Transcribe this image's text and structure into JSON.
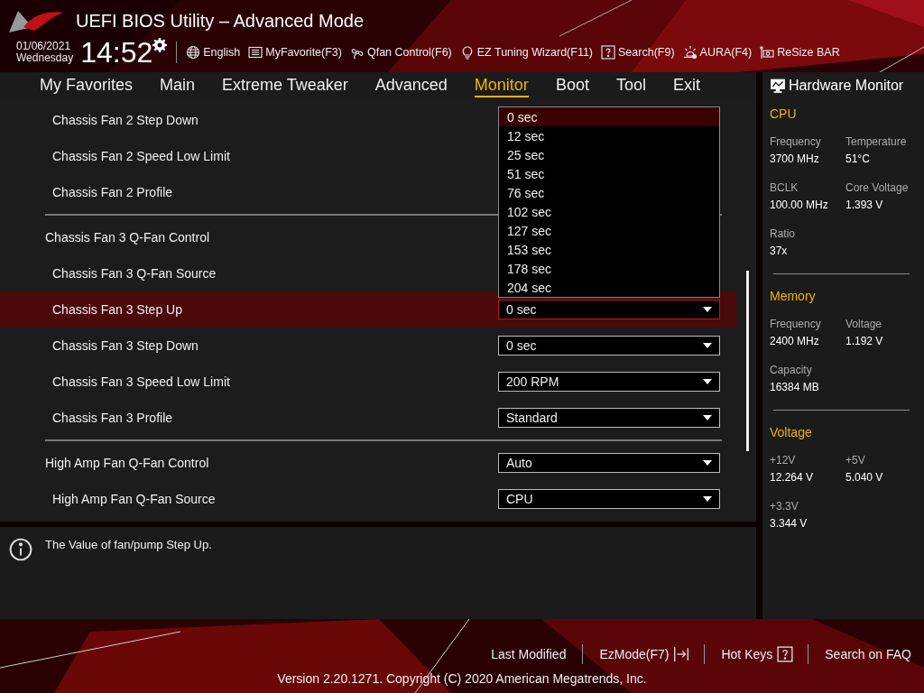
{
  "window": {
    "title": "UEFI BIOS Utility – Advanced Mode"
  },
  "clock": {
    "date": "01/06/2021",
    "day": "Wednesday",
    "time": "14:52"
  },
  "toolbar": [
    {
      "label": "English"
    },
    {
      "label": "MyFavorite(F3)"
    },
    {
      "label": "Qfan Control(F6)"
    },
    {
      "label": "EZ Tuning Wizard(F11)"
    },
    {
      "label": "Search(F9)"
    },
    {
      "label": "AURA(F4)"
    },
    {
      "label": "ReSize BAR"
    }
  ],
  "tabs": [
    {
      "label": "My Favorites",
      "selected": false
    },
    {
      "label": "Main",
      "selected": false
    },
    {
      "label": "Extreme Tweaker",
      "selected": false
    },
    {
      "label": "Advanced",
      "selected": false
    },
    {
      "label": "Monitor",
      "selected": true
    },
    {
      "label": "Boot",
      "selected": false
    },
    {
      "label": "Tool",
      "selected": false
    },
    {
      "label": "Exit",
      "selected": false
    }
  ],
  "settings": [
    {
      "kind": "setting",
      "label": "Chassis Fan 2 Step Down",
      "selected": false
    },
    {
      "kind": "setting",
      "label": "Chassis Fan 2 Speed Low Limit",
      "selected": false
    },
    {
      "kind": "setting",
      "label": "Chassis Fan 2 Profile",
      "selected": false
    },
    {
      "kind": "divider"
    },
    {
      "kind": "group",
      "label": "Chassis Fan 3 Q-Fan Control",
      "selected": false
    },
    {
      "kind": "setting",
      "label": "Chassis Fan 3 Q-Fan Source",
      "selected": false
    },
    {
      "kind": "setting",
      "label": "Chassis Fan 3 Step Up",
      "value": "0 sec",
      "selected": true
    },
    {
      "kind": "setting",
      "label": "Chassis Fan 3 Step Down",
      "value": "0 sec",
      "selected": false
    },
    {
      "kind": "setting",
      "label": "Chassis Fan 3 Speed Low Limit",
      "value": "200 RPM",
      "selected": false
    },
    {
      "kind": "setting",
      "label": "Chassis Fan 3 Profile",
      "value": "Standard",
      "selected": false
    },
    {
      "kind": "divider"
    },
    {
      "kind": "group",
      "label": "High Amp Fan Q-Fan Control",
      "value": "Auto",
      "selected": false
    },
    {
      "kind": "setting",
      "label": "High Amp Fan Q-Fan Source",
      "value": "CPU",
      "selected": false
    }
  ],
  "dropdown_options": [
    {
      "label": "0 sec",
      "selected": true
    },
    {
      "label": "12 sec",
      "selected": false
    },
    {
      "label": "25 sec",
      "selected": false
    },
    {
      "label": "51 sec",
      "selected": false
    },
    {
      "label": "76 sec",
      "selected": false
    },
    {
      "label": "102 sec",
      "selected": false
    },
    {
      "label": "127 sec",
      "selected": false
    },
    {
      "label": "153 sec",
      "selected": false
    },
    {
      "label": "178 sec",
      "selected": false
    },
    {
      "label": "204 sec",
      "selected": false
    }
  ],
  "help": {
    "text": "The Value of fan/pump Step Up."
  },
  "hardware_monitor": {
    "title": "Hardware Monitor",
    "sections": [
      {
        "title": "CPU",
        "items": [
          {
            "label": "Frequency",
            "value": "3700 MHz"
          },
          {
            "label": "Temperature",
            "value": "51°C"
          },
          {
            "label": "BCLK",
            "value": "100.00 MHz"
          },
          {
            "label": "Core Voltage",
            "value": "1.393 V"
          },
          {
            "label": "Ratio",
            "value": "37x"
          }
        ]
      },
      {
        "title": "Memory",
        "items": [
          {
            "label": "Frequency",
            "value": "2400 MHz"
          },
          {
            "label": "Voltage",
            "value": "1.192 V"
          },
          {
            "label": "Capacity",
            "value": "16384 MB"
          }
        ]
      },
      {
        "title": "Voltage",
        "items": [
          {
            "label": "+12V",
            "value": "12.264 V"
          },
          {
            "label": "+5V",
            "value": "5.040 V"
          },
          {
            "label": "+3.3V",
            "value": "3.344 V"
          }
        ]
      }
    ]
  },
  "footer": {
    "links": [
      {
        "label": "Last Modified"
      },
      {
        "label": "EzMode(F7)"
      },
      {
        "label": "Hot Keys"
      },
      {
        "label": "Search on FAQ"
      }
    ],
    "version": "Version 2.20.1271. Copyright (C) 2020 American Megatrends, Inc."
  }
}
